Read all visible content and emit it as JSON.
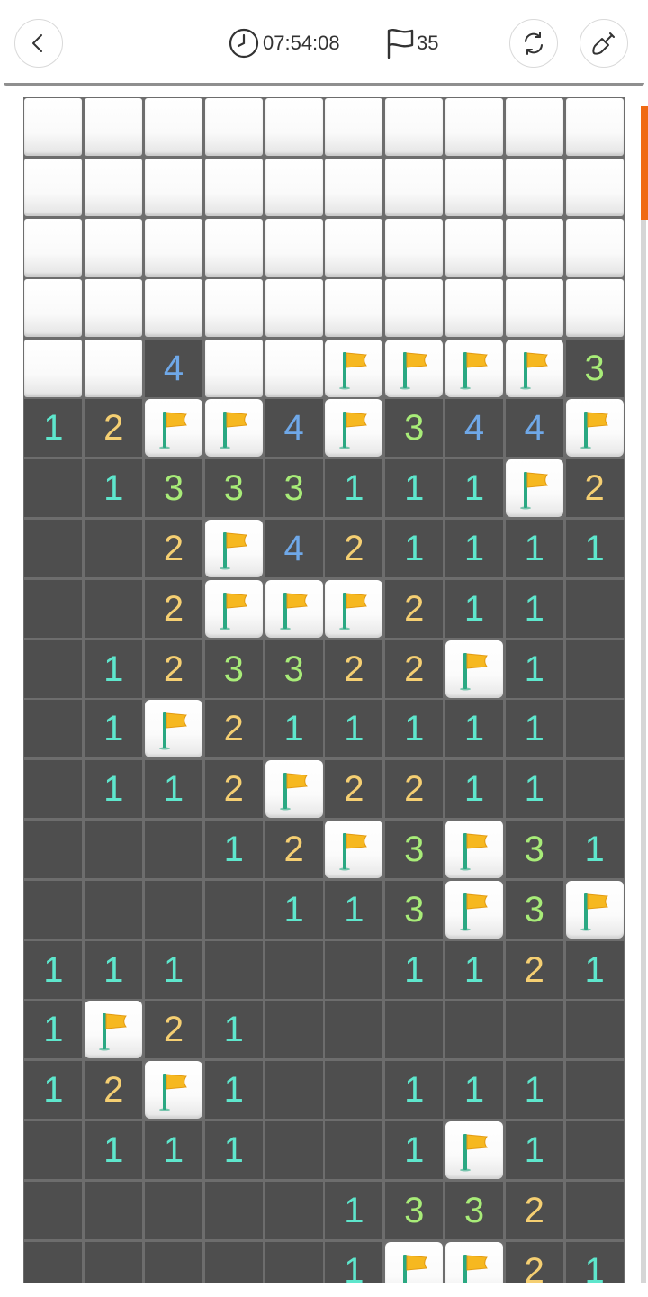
{
  "header": {
    "back_icon": "chevron-left-icon",
    "timer_icon": "clock-icon",
    "timer_value": "07:54:08",
    "flag_icon": "flag-outline-icon",
    "flags_remaining": "35",
    "restart_icon": "restart-icon",
    "dig_icon": "shovel-icon"
  },
  "colors": {
    "accent": "#f06a14",
    "open_cell": "#4e4e4e",
    "grid": "#6d6d6d",
    "num_1": "#5ee6cc",
    "num_2": "#f5cf72",
    "num_3": "#a8ec78",
    "num_4": "#6fa8e8"
  },
  "board": {
    "columns": 10,
    "legend": "H = covered, F = flagged, 0 = open empty, 1-4 = open number",
    "rows": [
      [
        "H",
        "H",
        "H",
        "H",
        "H",
        "H",
        "H",
        "H",
        "H",
        "H"
      ],
      [
        "H",
        "H",
        "H",
        "H",
        "H",
        "H",
        "H",
        "H",
        "H",
        "H"
      ],
      [
        "H",
        "H",
        "H",
        "H",
        "H",
        "H",
        "H",
        "H",
        "H",
        "H"
      ],
      [
        "H",
        "H",
        "H",
        "H",
        "H",
        "H",
        "H",
        "H",
        "H",
        "H"
      ],
      [
        "H",
        "H",
        "4",
        "H",
        "H",
        "F",
        "F",
        "F",
        "F",
        "3"
      ],
      [
        "1",
        "2",
        "F",
        "F",
        "4",
        "F",
        "3",
        "4",
        "4",
        "F"
      ],
      [
        "0",
        "1",
        "3",
        "3",
        "3",
        "1",
        "1",
        "1",
        "F",
        "2"
      ],
      [
        "0",
        "0",
        "2",
        "F",
        "4",
        "2",
        "1",
        "1",
        "1",
        "1"
      ],
      [
        "0",
        "0",
        "2",
        "F",
        "F",
        "F",
        "2",
        "1",
        "1",
        "0"
      ],
      [
        "0",
        "1",
        "2",
        "3",
        "3",
        "2",
        "2",
        "F",
        "1",
        "0"
      ],
      [
        "0",
        "1",
        "F",
        "2",
        "1",
        "1",
        "1",
        "1",
        "1",
        "0"
      ],
      [
        "0",
        "1",
        "1",
        "2",
        "F",
        "2",
        "2",
        "1",
        "1",
        "0"
      ],
      [
        "0",
        "0",
        "0",
        "1",
        "2",
        "F",
        "3",
        "F",
        "3",
        "1"
      ],
      [
        "0",
        "0",
        "0",
        "0",
        "1",
        "1",
        "3",
        "F",
        "3",
        "F"
      ],
      [
        "1",
        "1",
        "1",
        "0",
        "0",
        "0",
        "1",
        "1",
        "2",
        "1"
      ],
      [
        "1",
        "F",
        "2",
        "1",
        "0",
        "0",
        "0",
        "0",
        "0",
        "0"
      ],
      [
        "1",
        "2",
        "F",
        "1",
        "0",
        "0",
        "1",
        "1",
        "1",
        "0"
      ],
      [
        "0",
        "1",
        "1",
        "1",
        "0",
        "0",
        "1",
        "F",
        "1",
        "0"
      ],
      [
        "0",
        "0",
        "0",
        "0",
        "0",
        "1",
        "3",
        "3",
        "2",
        "0"
      ],
      [
        "0",
        "0",
        "0",
        "0",
        "0",
        "1",
        "F",
        "F",
        "2",
        "1"
      ]
    ]
  }
}
